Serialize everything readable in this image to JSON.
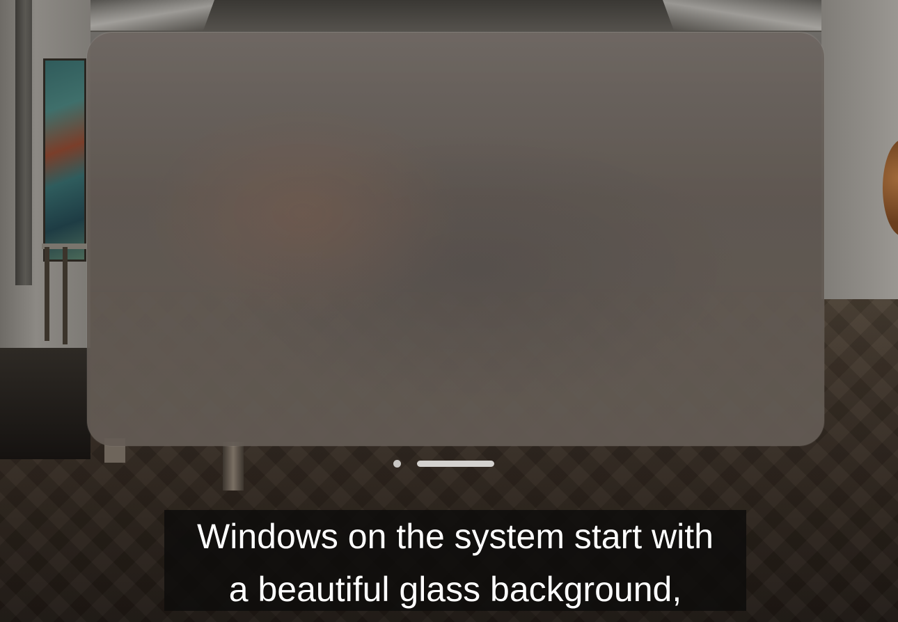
{
  "caption": {
    "line1": "Windows on the system start with",
    "line2": "a beautiful glass background,"
  },
  "window": {
    "controls": {
      "close_icon": "circle-dot",
      "grab_icon": "window-grab-bar"
    }
  },
  "colors": {
    "caption_background": "#0e0d0c",
    "caption_text": "#ffffff",
    "glass_tint": "#6b625b"
  }
}
